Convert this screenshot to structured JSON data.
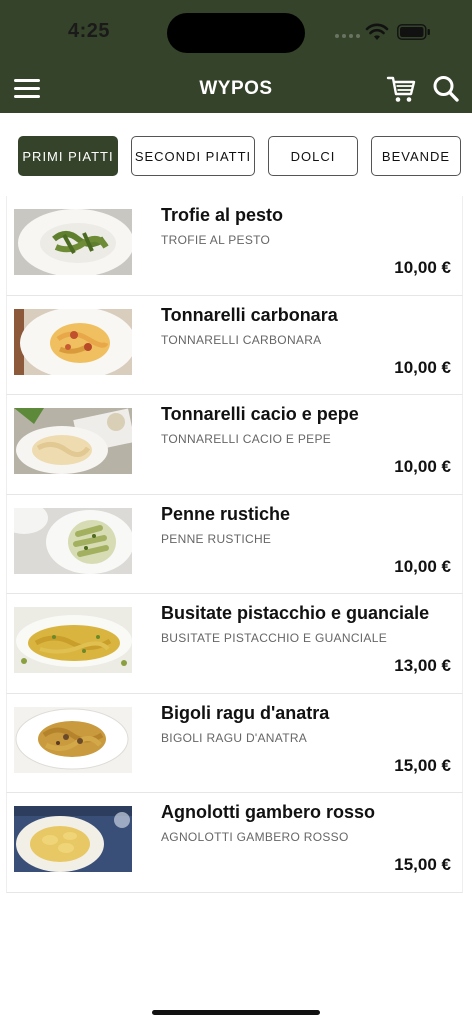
{
  "status_bar": {
    "time": "4:25"
  },
  "header": {
    "title": "WYPOS",
    "menu_icon": "hamburger-menu-icon",
    "cart_icon": "cart-icon",
    "search_icon": "search-icon",
    "background_color": "#35432a"
  },
  "categories": [
    {
      "label": "PRIMI PIATTI",
      "active": true
    },
    {
      "label": "SECONDI PIATTI",
      "active": false
    },
    {
      "label": "DOLCI",
      "active": false
    },
    {
      "label": "BEVANDE",
      "active": false
    }
  ],
  "items": [
    {
      "name": "Trofie al pesto",
      "subtitle": "TROFIE AL PESTO",
      "price": "10,00 €"
    },
    {
      "name": "Tonnarelli carbonara",
      "subtitle": "TONNARELLI CARBONARA",
      "price": "10,00 €"
    },
    {
      "name": "Tonnarelli cacio e pepe",
      "subtitle": "TONNARELLI CACIO E PEPE",
      "price": "10,00 €"
    },
    {
      "name": "Penne rustiche",
      "subtitle": "PENNE RUSTICHE",
      "price": "10,00 €"
    },
    {
      "name": "Busitate pistacchio e guanciale",
      "subtitle": "BUSITATE PISTACCHIO E GUANCIALE",
      "price": "13,00 €"
    },
    {
      "name": "Bigoli ragu d'anatra",
      "subtitle": "BIGOLI RAGU D'ANATRA",
      "price": "15,00 €"
    },
    {
      "name": "Agnolotti gambero rosso",
      "subtitle": "AGNOLOTTI GAMBERO ROSSO",
      "price": "15,00 €"
    }
  ]
}
